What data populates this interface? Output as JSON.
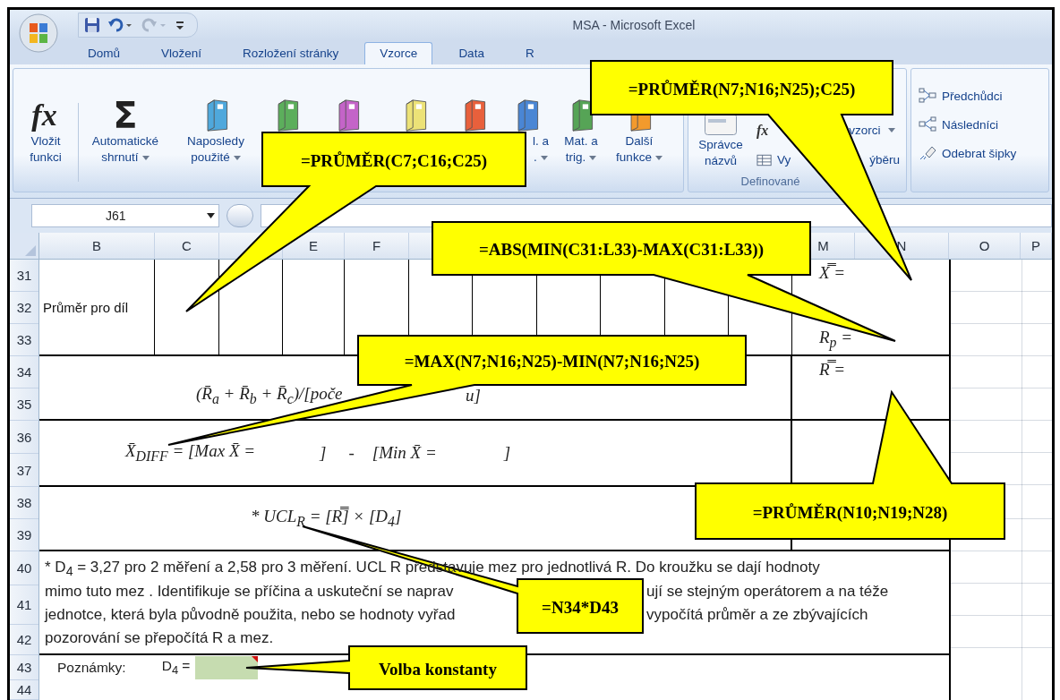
{
  "window": {
    "title": "MSA - Microsoft Excel"
  },
  "quick_access": {
    "undo": {
      "disabled": false
    },
    "redo": {
      "disabled": true
    }
  },
  "tabs": [
    {
      "label": "Domů",
      "selected": false
    },
    {
      "label": "Vložení",
      "selected": false
    },
    {
      "label": "Rozložení stránky",
      "selected": false
    },
    {
      "label": "Vzorce",
      "selected": true
    },
    {
      "label": "Data",
      "selected": false
    },
    {
      "label": "R",
      "selected": false
    }
  ],
  "function_library": [
    {
      "kind": "glyph",
      "glyph": "fx",
      "lines": [
        "Vložit",
        "funkci"
      ],
      "dropdown": false
    },
    {
      "kind": "glyph",
      "glyph": "Σ",
      "lines": [
        "Automatické",
        "shrnutí"
      ],
      "dropdown": true
    },
    {
      "kind": "book",
      "color": "#4fa8dc",
      "lines": [
        "Naposledy",
        "použité"
      ],
      "dropdown": true
    },
    {
      "kind": "book",
      "color": "#5cae5c"
    },
    {
      "kind": "book",
      "color": "#c464c8"
    },
    {
      "kind": "book",
      "color": "#ece277"
    },
    {
      "kind": "book",
      "color": "#e8603c"
    },
    {
      "kind": "book",
      "color": "#4a86d4",
      "lines": [
        "l. a",
        "."
      ],
      "dropdown": true
    },
    {
      "kind": "book",
      "color": "#56a456",
      "lines": [
        "Mat. a",
        "trig."
      ],
      "dropdown": true
    },
    {
      "kind": "book",
      "color": "#f39a2c",
      "lines": [
        "Další",
        "funkce"
      ],
      "dropdown": true
    }
  ],
  "defined_names": {
    "label": "Definované",
    "manager": [
      "Správce",
      "názvů"
    ],
    "use_row": {
      "glyph": "fx",
      "text": "vzorci",
      "dropdown": true
    },
    "create_row": {
      "left": "Vy",
      "right": "ýběru"
    }
  },
  "auditing": [
    {
      "kind": "precedents",
      "label": "Předchůdci"
    },
    {
      "kind": "dependents",
      "label": "Následníci"
    },
    {
      "kind": "remove",
      "label": "Odebrat šipky"
    }
  ],
  "formula_bar": {
    "name_box": "J61"
  },
  "column_headers": [
    {
      "label": "B"
    },
    {
      "label": "C"
    },
    {
      "label": "E"
    },
    {
      "label": "F"
    },
    {
      "label": "M"
    },
    {
      "label": "N"
    },
    {
      "label": "O"
    },
    {
      "label": "P"
    }
  ],
  "rows": [
    "31",
    "32",
    "33",
    "34",
    "35",
    "36",
    "37",
    "38",
    "39",
    "40",
    "41",
    "42",
    "43",
    "44"
  ],
  "cells": {
    "part_average_label": "Průměr pro díl",
    "grand_mean": "X̿ =",
    "part_range": "R$_{p}$ =",
    "mean_range": "R̿ =",
    "range_formula": "(R̄$_{a}$ + R̄$_{b}$ + R̄$_{c}$)/[poče",
    "range_formula_end": "u]",
    "x_diff": [
      "X̄$_{DIFF}$ = [Max X̄ =",
      "]",
      "-",
      "[Min X̄ =",
      "]"
    ],
    "ucl": "* UCL$_{R}$ = [R̿] × [D$_{4}$]"
  },
  "note_lines": [
    [
      "* D$_{4}$ = 3,27 pro 2 měření a 2,58 pro 3 měření. UCL R představuje mez pro jednotlivá R. Do kroužku se dají hodnoty"
    ],
    [
      "mimo tuto mez . Identifikuje se příčina a uskuteční se naprav",
      "ují se stejným operátorem a na téže"
    ],
    [
      "jednotce, která byla původně použita, nebo se hodnoty vyřad",
      "vypočítá průměr a ze zbývajících"
    ],
    [
      "pozorování se přepočítá R a mez."
    ]
  ],
  "notes_row": {
    "label": "Poznámky:",
    "d4_label": "D$_{4}$ =",
    "has_comment": true
  },
  "callouts": [
    "=PRŮMĚR(C7;C16;C25)",
    "=PRŮMĚR(N7;N16;N25);C25)",
    "=ABS(MIN(C31:L33)-MAX(C31:L33))",
    "=MAX(N7;N16;N25)-MIN(N7;N16;N25)",
    "=PRŮMĚR(N10;N19;N28)",
    "=N34*D43",
    "Volba konstanty"
  ]
}
